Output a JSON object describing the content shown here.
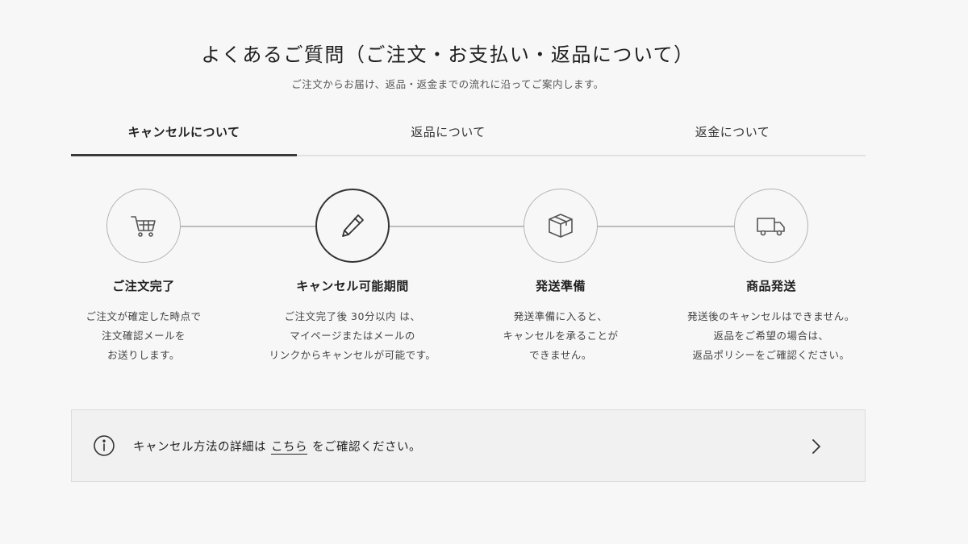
{
  "header": {
    "title": "よくあるご質問（ご注文・お支払い・返品について）",
    "subtitle": "ご注文からお届け、返品・返金までの流れに沿ってご案内します。"
  },
  "tabs": [
    {
      "label": "キャンセルについて",
      "active": true
    },
    {
      "label": "返品について",
      "active": false
    },
    {
      "label": "返金について",
      "active": false
    }
  ],
  "steps": [
    {
      "icon": "cart-icon",
      "title": "ご注文完了",
      "lines": [
        "ご注文が確定した時点で",
        "注文確認メールを",
        "お送りします。"
      ]
    },
    {
      "icon": "pencil-icon",
      "title": "キャンセル可能期間",
      "active": true,
      "lines": [
        "ご注文完了後 30分以内 は、",
        "マイページまたはメールの",
        "リンクからキャンセルが可能です。"
      ]
    },
    {
      "icon": "box-icon",
      "title": "発送準備",
      "lines": [
        "発送準備に入ると、",
        "キャンセルを承ることが",
        "できません。"
      ]
    },
    {
      "icon": "truck-icon",
      "title": "商品発送",
      "lines": [
        "発送後のキャンセルはできません。",
        "返品をご希望の場合は、",
        "返品ポリシーをご確認ください。"
      ]
    }
  ],
  "notice": {
    "icon": "info-icon",
    "prefix": "キャンセル方法の詳細は",
    "link": "こちら",
    "suffix": "をご確認ください。",
    "chevron": "chevron-right-icon"
  },
  "colors": {
    "background": "#f7f7f7",
    "active_tab_underline": "#3a3a3a",
    "connector": "#bdbdbd"
  }
}
